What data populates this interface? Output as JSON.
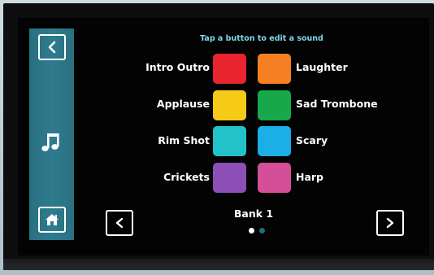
{
  "header": {
    "hint": "Tap a button to edit a sound"
  },
  "sidebar": {
    "back_icon": "chevron-left-icon",
    "section_icon": "music-note-icon",
    "home_icon": "home-icon"
  },
  "pads": [
    {
      "label": "Intro Outro",
      "color": "#e8242f"
    },
    {
      "label": "Laughter",
      "color": "#f57f22"
    },
    {
      "label": "Applause",
      "color": "#f6cb17"
    },
    {
      "label": "Sad Trombone",
      "color": "#16a84a"
    },
    {
      "label": "Rim Shot",
      "color": "#21c3c8"
    },
    {
      "label": "Scary",
      "color": "#1ab0e6"
    },
    {
      "label": "Crickets",
      "color": "#8b4fb7"
    },
    {
      "label": "Harp",
      "color": "#d54e98"
    }
  ],
  "bank": {
    "title": "Bank 1",
    "page_count": 2,
    "current_page": 1
  },
  "colors": {
    "accent": "#7fd8ec",
    "sidebar": "#2e7b8e",
    "dot_active": "#ffffff",
    "dot_inactive": "#1f6f7f"
  }
}
